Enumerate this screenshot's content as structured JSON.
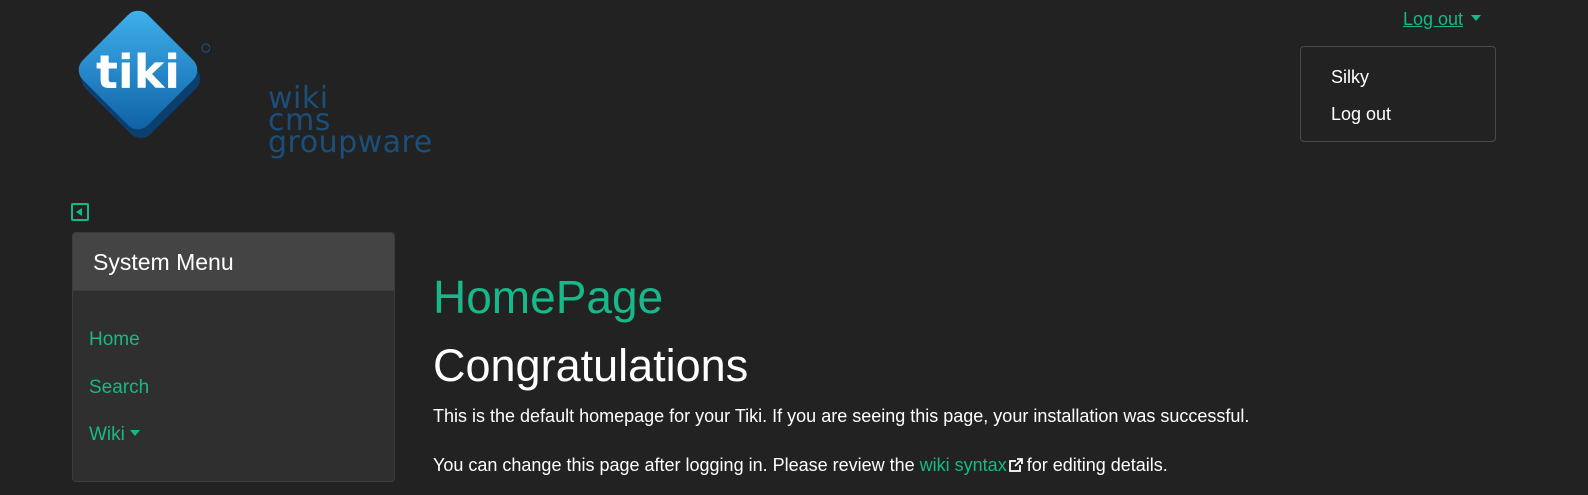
{
  "logo": {
    "mark_text": "tiki",
    "words": [
      "wiki",
      "cms",
      "groupware"
    ]
  },
  "user_menu": {
    "toggle_label": "Log out",
    "items": [
      "Silky",
      "Log out"
    ]
  },
  "sidebar": {
    "title": "System Menu",
    "items": [
      {
        "label": "Home"
      },
      {
        "label": "Search"
      },
      {
        "label": "Wiki"
      }
    ]
  },
  "main": {
    "page_title": "HomePage",
    "heading": "Congratulations",
    "para1": "This is the default homepage for your Tiki. If you are seeing this page, your installation was successful.",
    "para2_before": "You can change this page after logging in. Please review the ",
    "para2_link": "wiki syntax",
    "para2_after": "for editing details."
  },
  "colors": {
    "background": "#222222",
    "accent": "#17b889",
    "panel": "#2f2f2f",
    "panel_header": "#444444",
    "logo_text": "#1b4e7a",
    "logo_blue": "#1e8fd0"
  },
  "icons": {
    "sidebar_toggle": "collapse-left-icon",
    "external_link": "external-link-icon",
    "caret": "caret-down-icon"
  }
}
